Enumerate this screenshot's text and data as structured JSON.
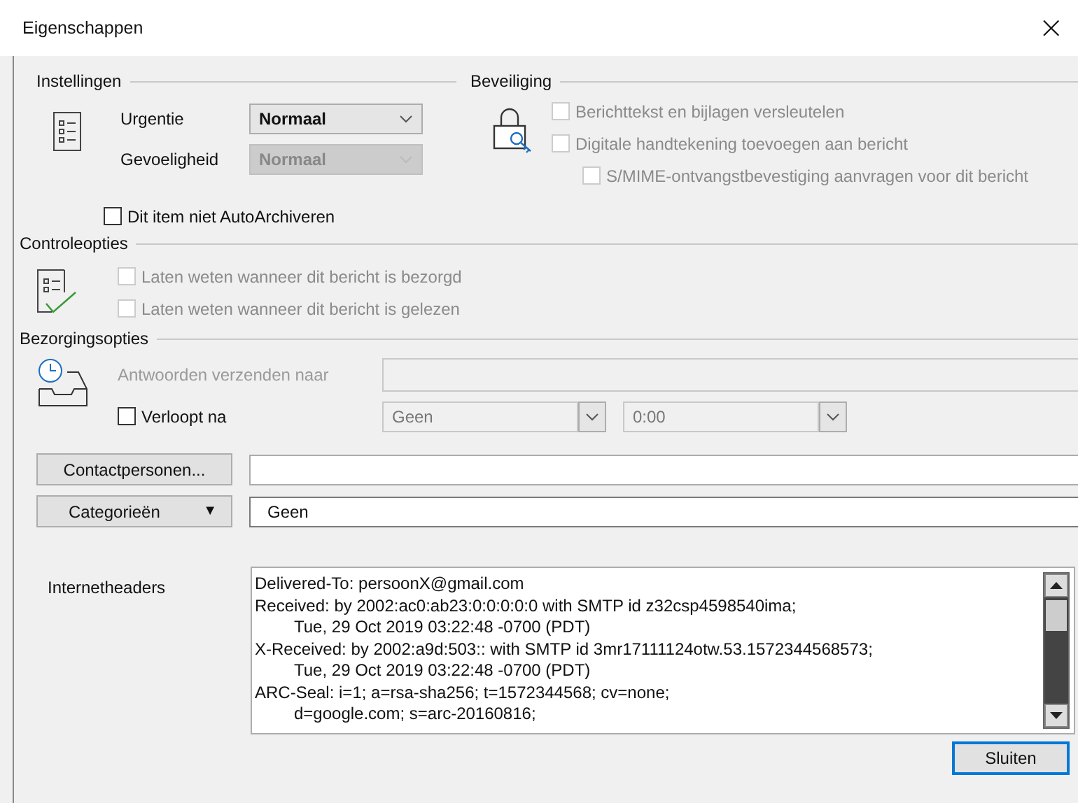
{
  "window": {
    "title": "Eigenschappen",
    "close": "×"
  },
  "settings": {
    "title": "Instellingen",
    "fields": [
      {
        "label": "Urgentie",
        "value": "Normaal",
        "disabled": false
      },
      {
        "label": "Gevoeligheid",
        "value": "Normaal",
        "disabled": true
      }
    ],
    "autoarchive": {
      "label": "Dit item niet AutoArchiveren",
      "checked": false
    }
  },
  "security": {
    "title": "Beveiliging",
    "options": [
      {
        "label": "Berichttekst en bijlagen versleutelen",
        "checked": false,
        "disabled": true,
        "indented": false
      },
      {
        "label": "Digitale handtekening toevoegen aan bericht",
        "checked": false,
        "disabled": true,
        "indented": false
      },
      {
        "label": "S/MIME-ontvangstbevestiging aanvragen voor dit bericht",
        "checked": false,
        "disabled": true,
        "indented": true
      }
    ]
  },
  "tracking": {
    "title": "Controleopties",
    "options": [
      {
        "label": "Laten weten wanneer dit bericht is bezorgd",
        "checked": false,
        "disabled": true
      },
      {
        "label": "Laten weten wanneer dit bericht is gelezen",
        "checked": false,
        "disabled": true
      }
    ]
  },
  "delivery": {
    "title": "Bezorgingsopties",
    "reply_to": {
      "label": "Antwoorden verzenden naar",
      "disabled": true
    },
    "expires": {
      "label": "Verloopt na",
      "checked": false,
      "date": "Geen",
      "time": "0:00"
    }
  },
  "contacts": {
    "button": "Contactpersonen..."
  },
  "categories": {
    "button": "Categorieën",
    "caret": "▼",
    "value": "Geen"
  },
  "headers": {
    "label": "Internetheaders",
    "lines": [
      {
        "text": "Delivered-To: persoonX@gmail.com",
        "indented": false
      },
      {
        "text": "Received: by 2002:ac0:ab23:0:0:0:0:0 with SMTP id z32csp4598540ima;",
        "indented": false
      },
      {
        "text": "Tue, 29 Oct 2019 03:22:48 -0700 (PDT)",
        "indented": true
      },
      {
        "text": "X-Received: by 2002:a9d:503:: with SMTP id 3mr17111124otw.53.1572344568573;",
        "indented": false
      },
      {
        "text": "Tue, 29 Oct 2019 03:22:48 -0700 (PDT)",
        "indented": true
      },
      {
        "text": "ARC-Seal: i=1; a=rsa-sha256; t=1572344568; cv=none;",
        "indented": false
      },
      {
        "text": "d=google.com; s=arc-20160816;",
        "indented": true
      }
    ]
  },
  "buttons": [
    {
      "label": "Sluiten",
      "default": true
    }
  ]
}
